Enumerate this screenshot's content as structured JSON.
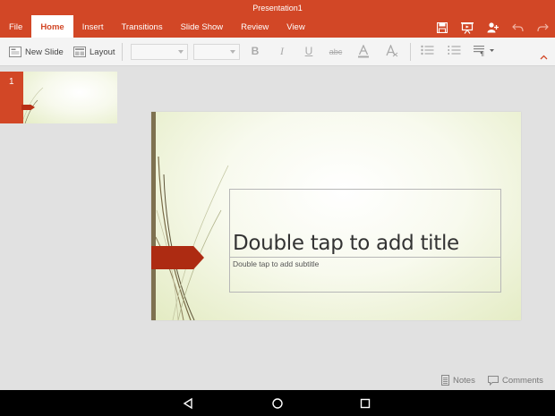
{
  "window": {
    "title": "Presentation1"
  },
  "tabs": [
    {
      "label": "File",
      "active": false
    },
    {
      "label": "Home",
      "active": true
    },
    {
      "label": "Insert",
      "active": false
    },
    {
      "label": "Transitions",
      "active": false
    },
    {
      "label": "Slide Show",
      "active": false
    },
    {
      "label": "Review",
      "active": false
    },
    {
      "label": "View",
      "active": false
    }
  ],
  "title_icons": [
    "save-icon",
    "present-icon",
    "share-icon",
    "undo-icon",
    "redo-icon"
  ],
  "ribbon": {
    "new_slide_label": "New Slide",
    "layout_label": "Layout",
    "font_name": "",
    "font_size": "",
    "format_icons": [
      "bold-icon",
      "italic-icon",
      "underline-icon",
      "strikethrough-icon",
      "font-color-icon",
      "clear-formatting-icon"
    ],
    "list_icons": [
      "bullets-icon",
      "numbering-icon",
      "paragraph-icon"
    ],
    "collapse_icon": "chevron-up-icon"
  },
  "thumbnails": [
    {
      "number": "1",
      "selected": true
    }
  ],
  "slide": {
    "title_placeholder": "Double tap to add title",
    "subtitle_placeholder": "Double tap to add subtitle"
  },
  "status": {
    "notes_label": "Notes",
    "comments_label": "Comments"
  },
  "android_nav": [
    "back-icon",
    "home-icon",
    "recents-icon"
  ],
  "colors": {
    "accent": "#d24726",
    "ribbon_bg": "#f4f4f4",
    "workspace_bg": "#e1e1e1",
    "slide_tag": "#ad2b12",
    "slide_bar": "#7e7150"
  }
}
